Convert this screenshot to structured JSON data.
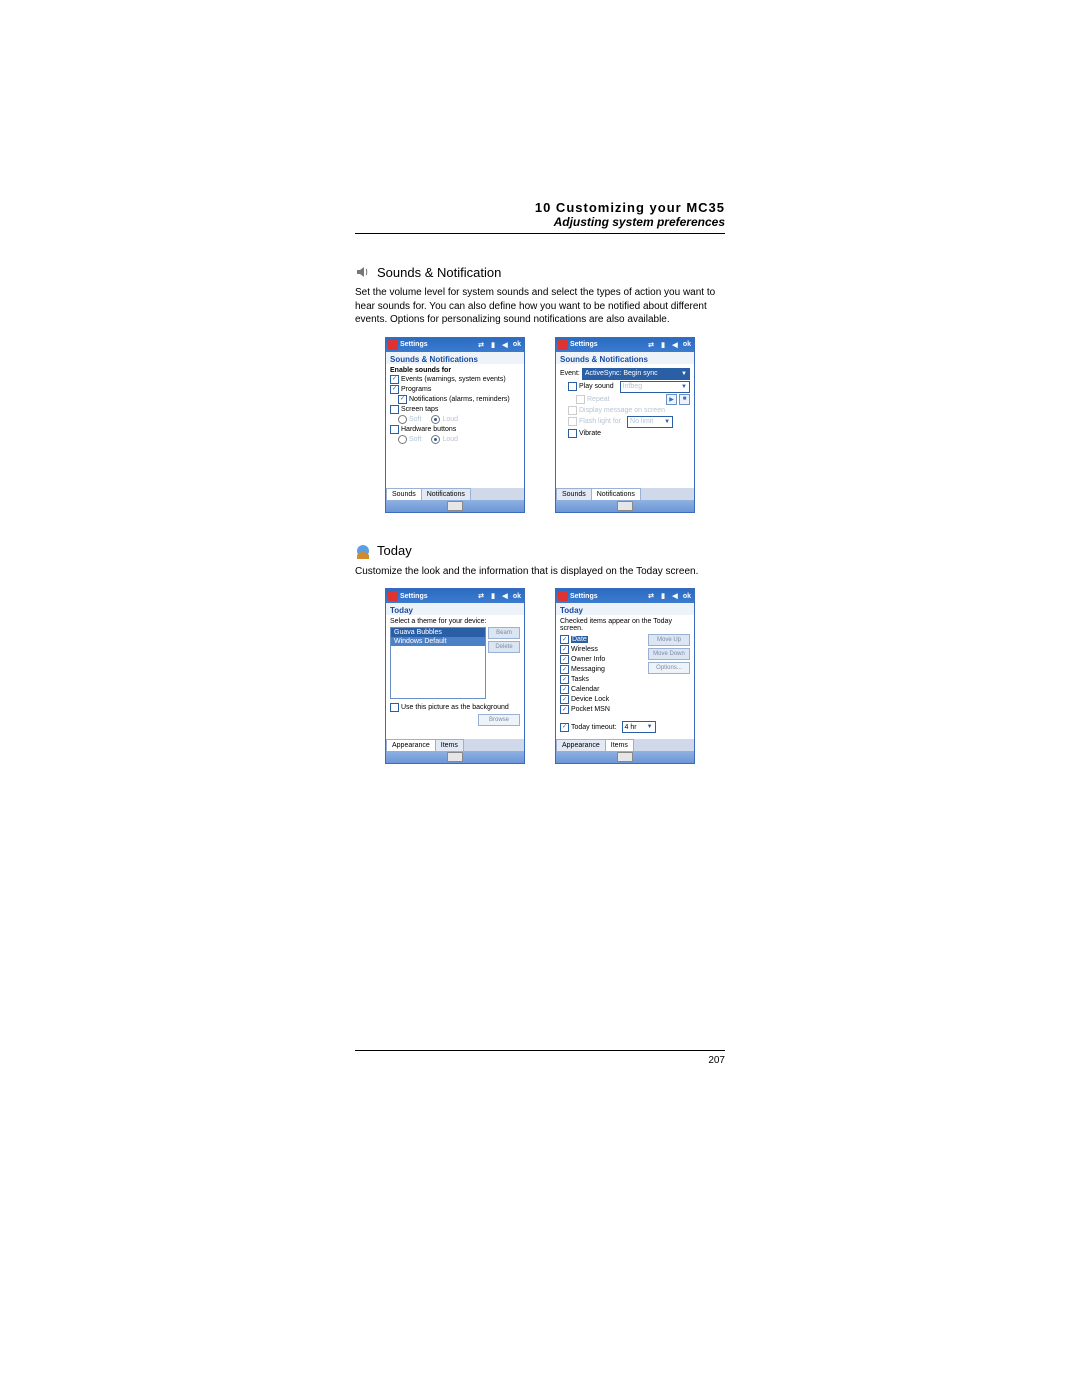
{
  "header": {
    "chapter": "10 Customizing your MC35",
    "subtitle": "Adjusting system preferences"
  },
  "section1": {
    "title": "Sounds & Notification",
    "body": "Set the volume level for system sounds and select the types of action you want to hear sounds for. You can also define how you want to be notified about different events. Options for personalizing sound notifications are also available."
  },
  "section2": {
    "title": "Today",
    "body": "Customize the look and the information that is displayed on the Today screen."
  },
  "shot_common": {
    "titlebar": "Settings",
    "ok": "ok",
    "subhead_sounds": "Sounds & Notifications",
    "subhead_today": "Today"
  },
  "sounds_tab": {
    "heading": "Enable sounds for",
    "events": "Events (warnings, system events)",
    "programs": "Programs",
    "notifications": "Notifications (alarms, reminders)",
    "screen_taps": "Screen taps",
    "hardware_buttons": "Hardware buttons",
    "soft": "Soft",
    "loud": "Loud",
    "tab_sounds": "Sounds",
    "tab_notifications": "Notifications"
  },
  "notif_tab": {
    "event_label": "Event:",
    "event_value": "ActiveSync: Begin sync",
    "play_sound": "Play sound",
    "sound_value": "Infbeg",
    "repeat": "Repeat",
    "display_msg": "Display message on screen",
    "flash": "Flash light for",
    "flash_value": "No limit",
    "vibrate": "Vibrate"
  },
  "today_appearance": {
    "prompt": "Select a theme for your device:",
    "theme1": "Guava Bubbles",
    "theme2": "Windows Default",
    "btn_beam": "Beam",
    "btn_delete": "Delete",
    "use_picture": "Use this picture as the background",
    "btn_browse": "Browse",
    "tab_appearance": "Appearance",
    "tab_items": "Items"
  },
  "today_items": {
    "prompt": "Checked items appear on the Today screen.",
    "i1": "Date",
    "i2": "Wireless",
    "i3": "Owner Info",
    "i4": "Messaging",
    "i5": "Tasks",
    "i6": "Calendar",
    "i7": "Device Lock",
    "i8": "Pocket MSN",
    "btn_up": "Move Up",
    "btn_down": "Move Down",
    "btn_opt": "Options...",
    "timeout_label": "Today timeout:",
    "timeout_value": "4 hr"
  },
  "page_number": "207"
}
